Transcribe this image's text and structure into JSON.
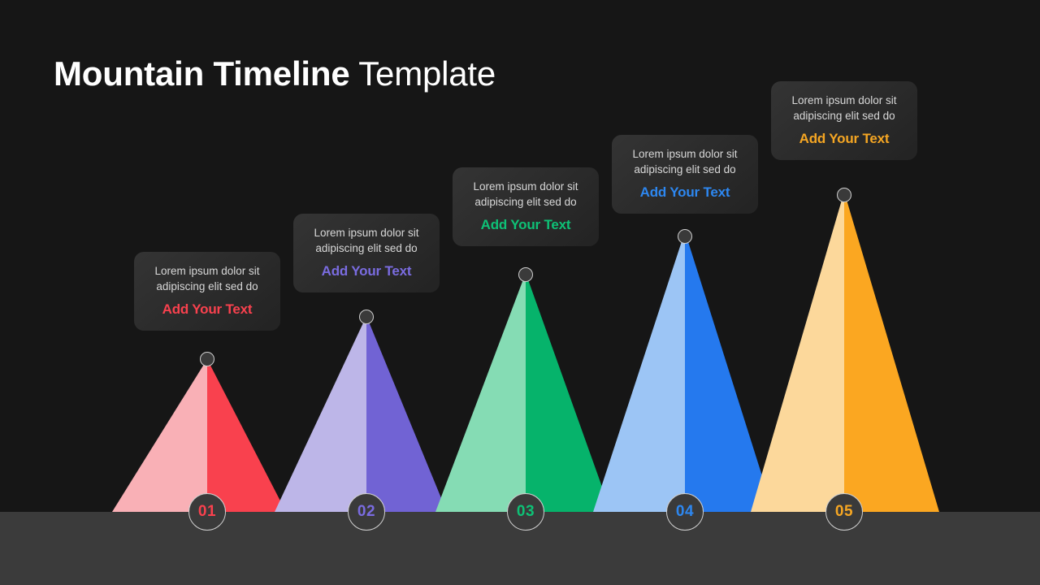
{
  "slide": {
    "title_strong": "Mountain Timeline",
    "title_light": "Template",
    "background_color": "#161616",
    "ground_color": "#3b3b3b"
  },
  "steps": [
    {
      "number": "01",
      "body": "Lorem ipsum dolor sit adipiscing elit sed do",
      "body_line1": "Lorem ipsum dolor sit",
      "body_line2": "adipiscing elit sed do",
      "cta": "Add Your Text",
      "color_light": "#f9b0b6",
      "color_dark": "#f9414e",
      "accent": "#f9414e"
    },
    {
      "number": "02",
      "body": "Lorem ipsum dolor sit adipiscing elit sed do",
      "body_line1": "Lorem ipsum dolor sit",
      "body_line2": "adipiscing elit sed do",
      "cta": "Add Your Text",
      "color_light": "#bdb6e8",
      "color_dark": "#7163d4",
      "accent": "#7a6ce0"
    },
    {
      "number": "03",
      "body": "Lorem ipsum dolor sit adipiscing elit sed do",
      "body_line1": "Lorem ipsum dolor sit",
      "body_line2": "adipiscing elit sed do",
      "cta": "Add Your Text",
      "color_light": "#85dcb4",
      "color_dark": "#06b36b",
      "accent": "#0ec176"
    },
    {
      "number": "04",
      "body": "Lorem ipsum dolor sit adipiscing elit sed do",
      "body_line1": "Lorem ipsum dolor sit",
      "body_line2": "adipiscing elit sed do",
      "cta": "Add Your Text",
      "color_light": "#9cc5f5",
      "color_dark": "#2579ee",
      "accent": "#2d87f0"
    },
    {
      "number": "05",
      "body": "Lorem ipsum dolor sit adipiscing elit sed do",
      "body_line1": "Lorem ipsum dolor sit",
      "body_line2": "adipiscing elit sed do",
      "cta": "Add Your Text",
      "color_light": "#fcd89b",
      "color_dark": "#fba721",
      "accent": "#f5a623"
    }
  ]
}
